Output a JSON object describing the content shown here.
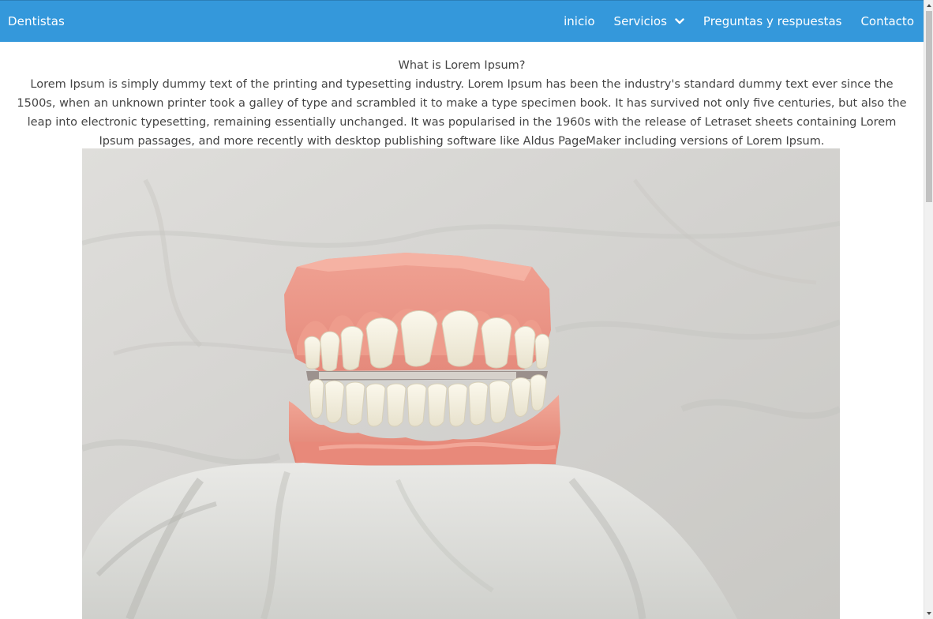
{
  "navbar": {
    "brand": "Dentistas",
    "items": [
      {
        "label": "inicio"
      },
      {
        "label": "Servicios",
        "has_dropdown": true
      },
      {
        "label": "Preguntas y respuestas"
      },
      {
        "label": "Contacto"
      }
    ],
    "background_color": "#3498db"
  },
  "main": {
    "title": "What is Lorem Ipsum?",
    "paragraph": "Lorem Ipsum is simply dummy text of the printing and typesetting industry. Lorem Ipsum has been the industry's standard dummy text ever since the 1500s, when an unknown printer took a galley of type and scrambled it to make a type specimen book. It has survived not only five centuries, but also the leap into electronic typesetting, remaining essentially unchanged. It was popularised in the 1960s with the release of Letraset sheets containing Lorem Ipsum passages, and more recently with desktop publishing software like Aldus PageMaker including versions of Lorem Ipsum.",
    "image_subject": "dental-model-photo"
  },
  "icons": {
    "dropdown": "chevron-down-icon",
    "scroll_up": "scroll-up-arrow-icon",
    "scroll_down": "scroll-down-arrow-icon"
  }
}
